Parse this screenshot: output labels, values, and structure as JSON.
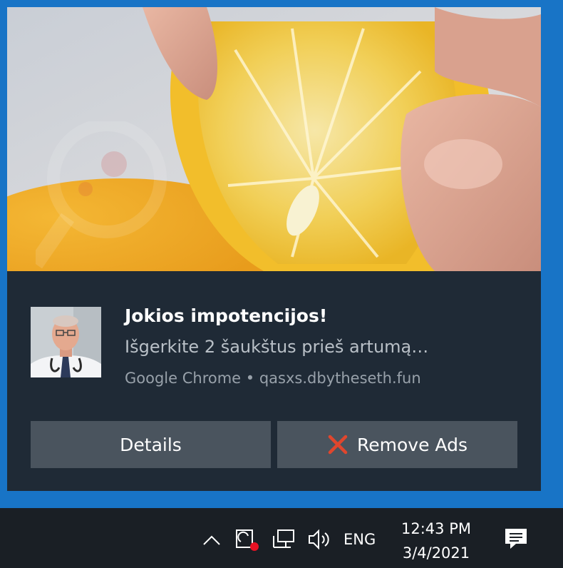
{
  "notification": {
    "title": "Jokios impotencijos!",
    "body": "Išgerkite 2 šaukštus prieš artumą…",
    "attribution": "Google Chrome • qasxs.dbytheseth.fun",
    "hero_image": "lemon-squeeze-photo",
    "avatar_image": "doctor-portrait-photo",
    "buttons": {
      "details_label": "Details",
      "remove_label": "Remove Ads",
      "remove_icon": "red-x-icon"
    },
    "watermark": "pcrisk-logo"
  },
  "taskbar": {
    "icons": [
      "chevron-up-icon",
      "sync-alert-icon",
      "network-icon",
      "volume-icon",
      "action-center-icon"
    ],
    "language": "ENG",
    "time": "12:43 PM",
    "date": "3/4/2021"
  },
  "colors": {
    "accent_blue": "#1874c6",
    "toast_bg": "#1f2a36",
    "button_bg": "#4a545e",
    "taskbar_bg": "#1a1f25",
    "alert_dot": "#e81123",
    "remove_x": "#e0462d"
  }
}
